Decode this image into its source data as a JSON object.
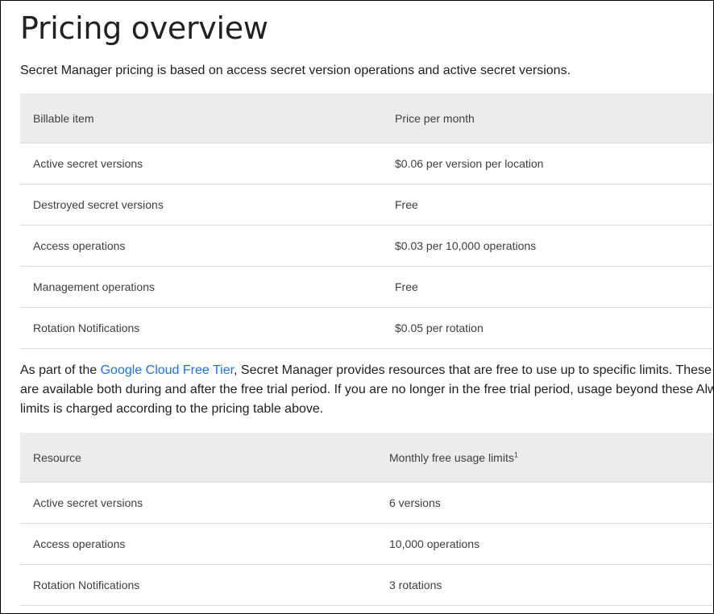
{
  "page": {
    "title": "Pricing overview",
    "intro": "Secret Manager pricing is based on access secret version operations and active secret versions."
  },
  "pricing_table": {
    "headers": [
      "Billable item",
      "Price per month"
    ],
    "rows": [
      [
        "Active secret versions",
        "$0.06 per version per location"
      ],
      [
        "Destroyed secret versions",
        "Free"
      ],
      [
        "Access operations",
        "$0.03 per 10,000 operations"
      ],
      [
        "Management operations",
        "Free"
      ],
      [
        "Rotation Notifications",
        "$0.05 per rotation"
      ]
    ]
  },
  "free_tier": {
    "line1_prefix": "As part of the ",
    "link_text": "Google Cloud Free Tier",
    "line1_suffix": ", Secret Manager provides resources that are free to use up to specific limits. These u",
    "line2": "are available both during and after the free trial period. If you are no longer in the free trial period, usage beyond these Alw",
    "line3": "limits is charged according to the pricing table above."
  },
  "free_table": {
    "headers": [
      "Resource",
      "Monthly free usage limits"
    ],
    "header_footnote": "1",
    "rows": [
      [
        "Active secret versions",
        "6 versions"
      ],
      [
        "Access operations",
        "10,000 operations"
      ],
      [
        "Rotation Notifications",
        "3 rotations"
      ]
    ]
  }
}
